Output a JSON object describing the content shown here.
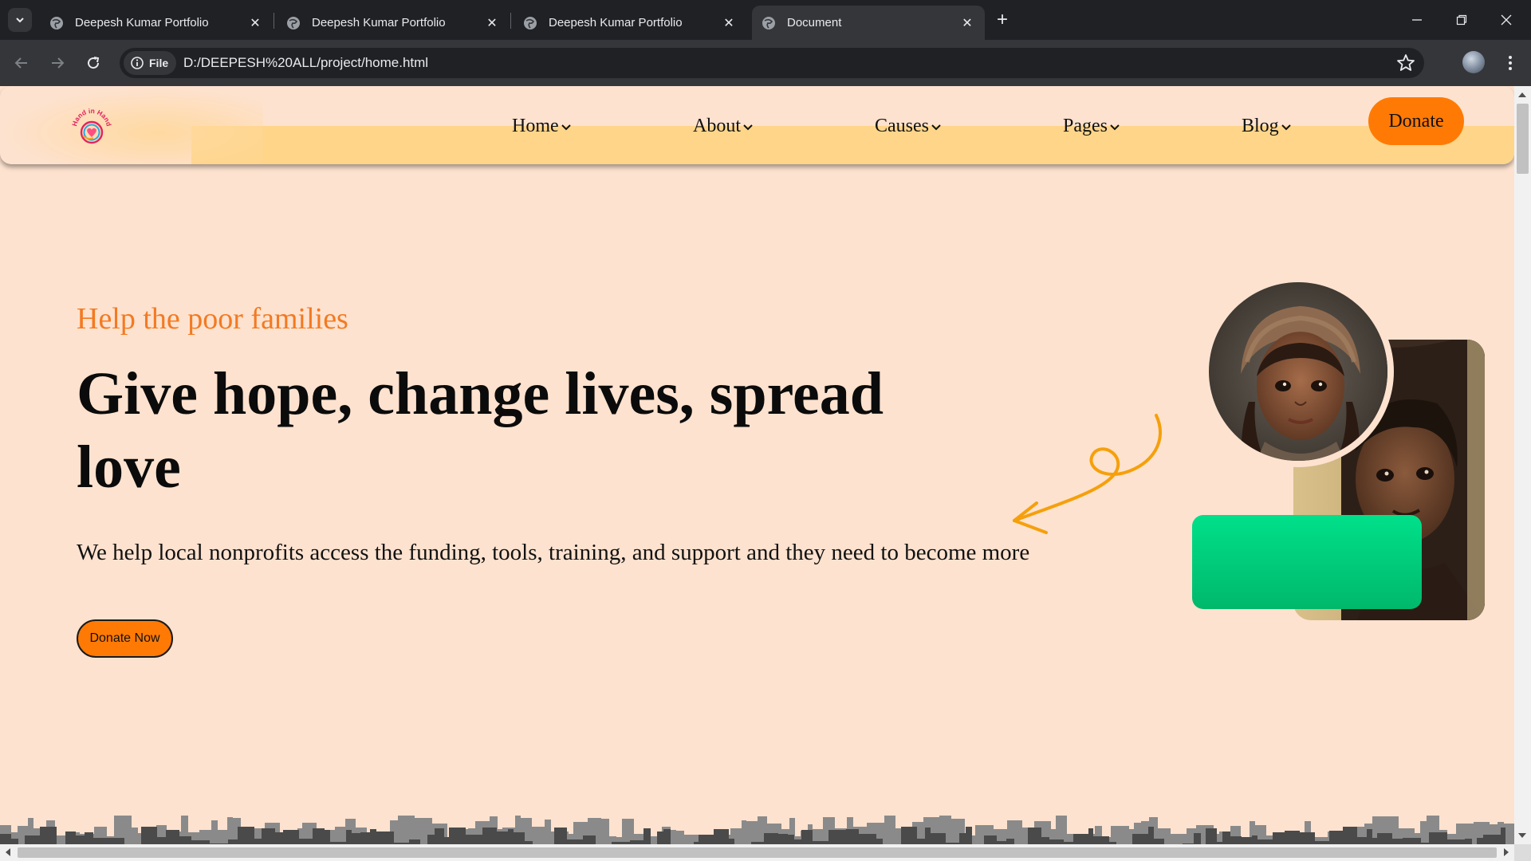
{
  "browser": {
    "tabs": [
      {
        "title": "Deepesh Kumar Portfolio",
        "active": false
      },
      {
        "title": "Deepesh Kumar Portfolio",
        "active": false
      },
      {
        "title": "Deepesh Kumar Portfolio",
        "active": false
      },
      {
        "title": "Document",
        "active": true
      }
    ],
    "site_chip_label": "File",
    "url": "D:/DEEPESH%20ALL/project/home.html"
  },
  "site": {
    "logo_text": "Hand in Hand",
    "nav": [
      {
        "label": "Home"
      },
      {
        "label": "About"
      },
      {
        "label": "Causes"
      },
      {
        "label": "Pages"
      },
      {
        "label": "Blog"
      }
    ],
    "donate_label": "Donate"
  },
  "hero": {
    "tagline": "Help the poor families",
    "title": "Give hope, change lives, spread love",
    "text": "We help local nonprofits access the funding, tools, training, and support and they need to become more",
    "cta_label": "Donate Now"
  },
  "colors": {
    "page_bg": "#fde2cf",
    "header_band": "#ffd58a",
    "accent_orange": "#ff7a05",
    "tagline_orange": "#f37a22",
    "green_card": "#00c978"
  },
  "icons": [
    "tab-search-icon",
    "globe-icon",
    "close-icon",
    "plus-icon",
    "minimize-icon",
    "restore-icon",
    "window-close-icon",
    "back-arrow-icon",
    "forward-arrow-icon",
    "reload-icon",
    "info-icon",
    "star-icon",
    "profile-avatar",
    "more-menu-icon",
    "chevron-down-icon",
    "arrow-swirl-icon"
  ]
}
